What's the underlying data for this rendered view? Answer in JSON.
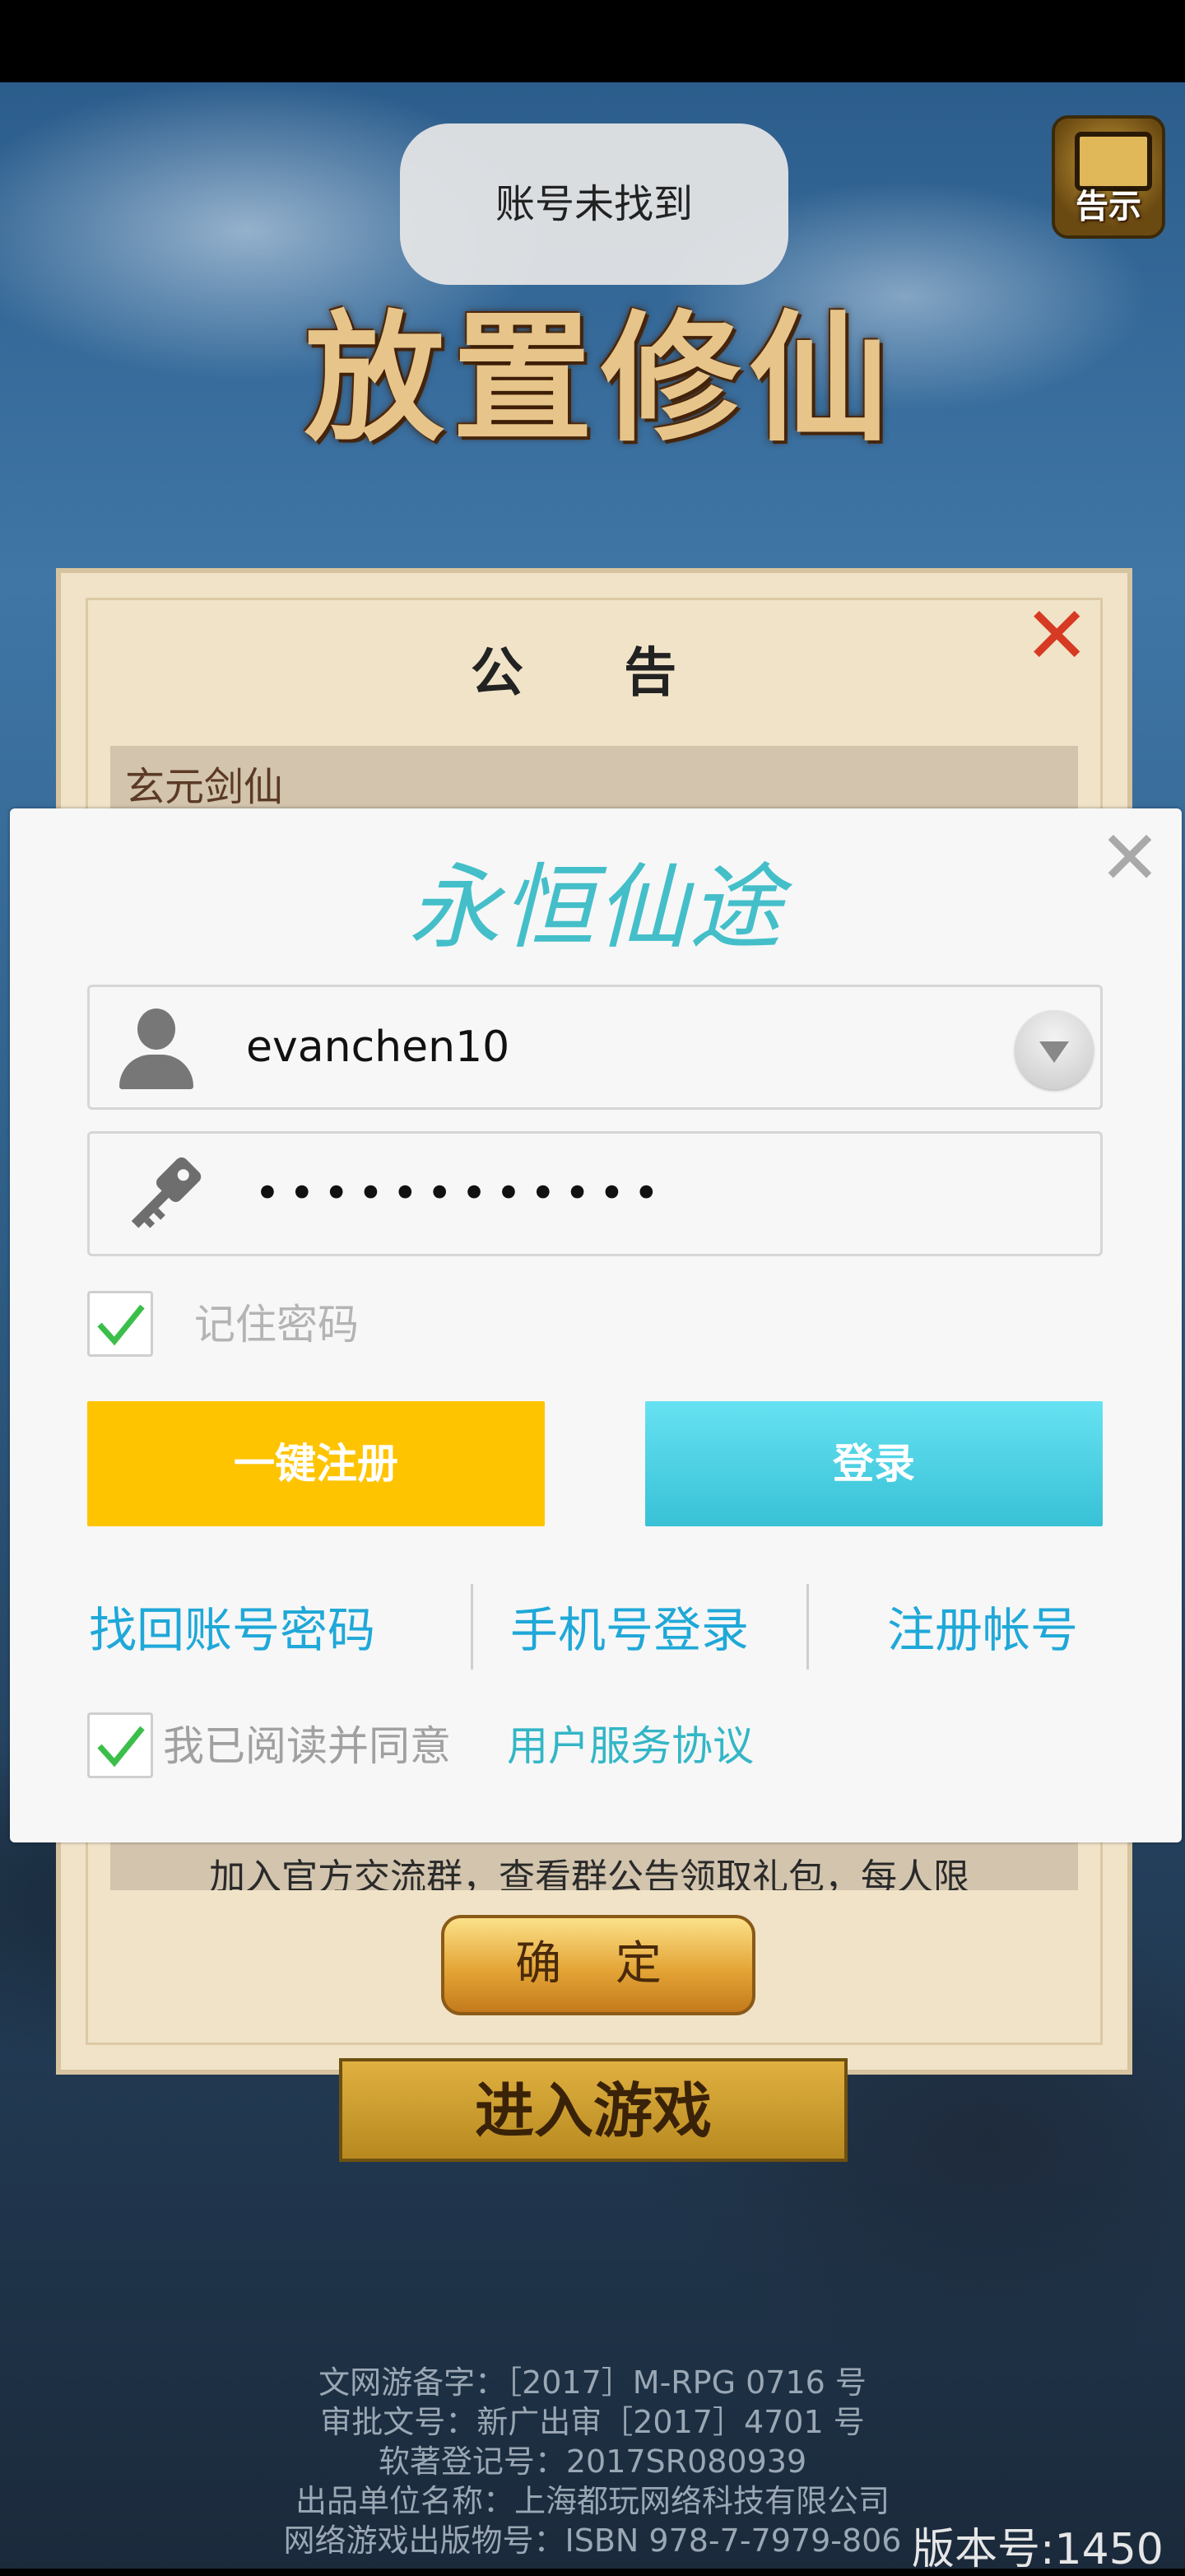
{
  "toast": {
    "message": "账号未找到"
  },
  "game": {
    "logo_text": "放置修仙",
    "notice_button_label": "告示",
    "enter_button_label": "进入游戏",
    "version_label": "版本号:1450"
  },
  "announcement": {
    "title": "公 告",
    "subtitle": "玄元剑仙",
    "body_snippet": "加入官方交流群，查看群公告领取礼包，每人限",
    "confirm_label": "确 定"
  },
  "login": {
    "brand": "永恒仙途",
    "username_value": "evanchen10",
    "password_mask": "••••••••••••",
    "remember_label": "记住密码",
    "remember_checked": true,
    "quick_register_label": "一键注册",
    "login_label": "登录",
    "recover_label": "找回账号密码",
    "phone_login_label": "手机号登录",
    "signup_label": "注册帐号",
    "agree_prefix": "我已阅读并同意",
    "agree_link": "用户服务协议",
    "agree_checked": true
  },
  "footer": {
    "line1": "文网游备字：［2017］M-RPG 0716 号",
    "line2": "审批文号：新广出审［2017］4701 号",
    "line3": "软著登记号：2017SR080939",
    "line4": "出品单位名称：上海都玩网络科技有限公司",
    "line5": "网络游戏出版物号：ISBN 978-7-7979-806"
  },
  "colors": {
    "accent_cyan": "#38c1d6",
    "accent_yellow": "#ffc400",
    "link_blue": "#1fa8d8",
    "check_green": "#3bbf4a"
  }
}
